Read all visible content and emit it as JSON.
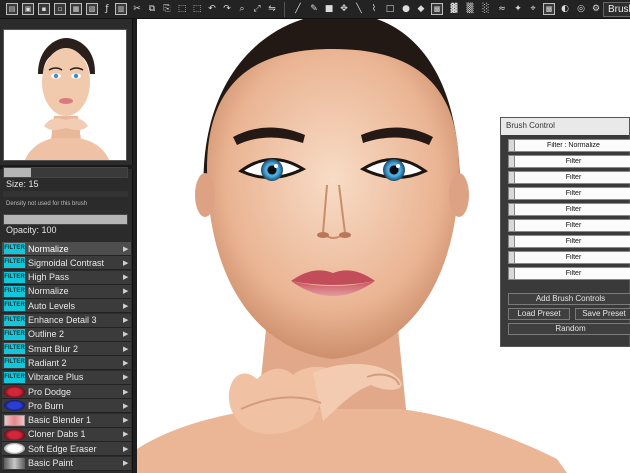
{
  "toolbar": {
    "title": "Brush",
    "icons": [
      "new-file",
      "open-file",
      "save-file",
      "save-as",
      "export",
      "import",
      "copy",
      "paste",
      "undo",
      "redo",
      "zoom",
      "fit",
      "pan",
      "flip",
      "rotate",
      "mirror",
      "brush",
      "eraser",
      "select",
      "move",
      "line",
      "rectangle",
      "ellipse",
      "fill",
      "pattern",
      "gradient",
      "blur",
      "smudge",
      "color-picker",
      "settings"
    ]
  },
  "left_panel": {
    "size_label": "Size: 15",
    "size_level": 0.22,
    "density_label": "Density not used for this brush",
    "density_level": 1.0,
    "opacity_label": "Opacity: 100",
    "opacity_level": 1.0,
    "brushes": [
      {
        "name": "Normalize",
        "icon": "filter",
        "icon_text": "FILTER",
        "selected": true
      },
      {
        "name": "Sigmoidal Contrast",
        "icon": "filter",
        "icon_text": "FILTER",
        "selected": false
      },
      {
        "name": "High Pass",
        "icon": "filter",
        "icon_text": "FILTER",
        "selected": false
      },
      {
        "name": "Normalize",
        "icon": "filter",
        "icon_text": "FILTER",
        "selected": false
      },
      {
        "name": "Auto Levels",
        "icon": "filter",
        "icon_text": "FILTER",
        "selected": false
      },
      {
        "name": "Enhance Detail 3",
        "icon": "filter",
        "icon_text": "FILTER",
        "selected": false
      },
      {
        "name": "Outline 2",
        "icon": "filter",
        "icon_text": "FILTER",
        "selected": false
      },
      {
        "name": "Smart Blur 2",
        "icon": "filter",
        "icon_text": "FILTER",
        "selected": false
      },
      {
        "name": "Radiant 2",
        "icon": "filter",
        "icon_text": "FILTER",
        "selected": false
      },
      {
        "name": "Vibrance Plus",
        "icon": "filter",
        "icon_text": "FILTER",
        "selected": false
      },
      {
        "name": "Pro Dodge",
        "icon": "red",
        "icon_text": "",
        "selected": false
      },
      {
        "name": "Pro Burn",
        "icon": "blue",
        "icon_text": "",
        "selected": false
      },
      {
        "name": "Basic Blender 1",
        "icon": "pale",
        "icon_text": "",
        "selected": false
      },
      {
        "name": "Cloner Dabs 1",
        "icon": "red",
        "icon_text": "",
        "selected": false
      },
      {
        "name": "Soft Edge Eraser",
        "icon": "white",
        "icon_text": "",
        "selected": false
      },
      {
        "name": "Basic Paint",
        "icon": "grey",
        "icon_text": "",
        "selected": false
      }
    ]
  },
  "dialog": {
    "title": "Brush Control",
    "filters": [
      "Filter : Normalize",
      "Filter",
      "Filter",
      "Filter",
      "Filter",
      "Filter",
      "Filter",
      "Filter",
      "Filter"
    ],
    "add_button": "Add Brush Controls",
    "load_button": "Load Preset",
    "save_button": "Save Preset",
    "random_button": "Random"
  },
  "colors": {
    "filter_badge": "#12c7d9",
    "panel_bg": "#2b2b2b",
    "dialog_bg": "#3a3a3a"
  }
}
